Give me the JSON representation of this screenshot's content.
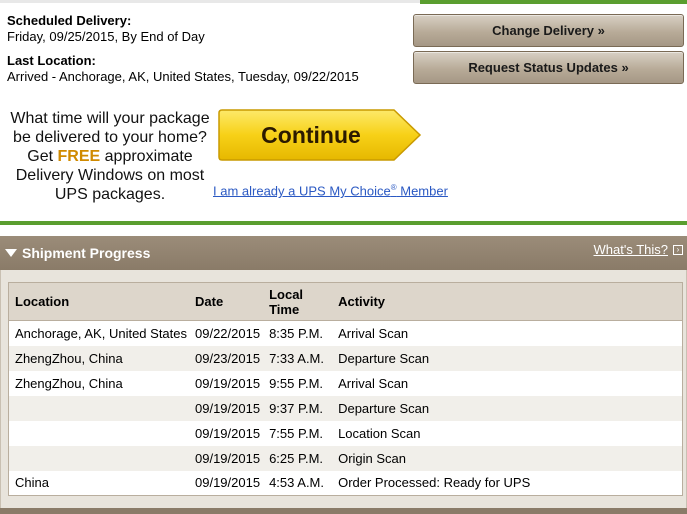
{
  "delivery": {
    "scheduled_label": "Scheduled Delivery:",
    "scheduled_value": "Friday, 09/25/2015, By End of Day",
    "last_location_label": "Last Location:",
    "last_location_value": "Arrived - Anchorage, AK, United States, Tuesday, 09/22/2015"
  },
  "buttons": {
    "change_delivery": "Change Delivery »",
    "request_updates": "Request Status Updates »"
  },
  "promo": {
    "line1": "What time will your package be delivered to your home? Get ",
    "free": "FREE",
    "line2": " approximate Delivery Windows on most UPS packages.",
    "continue_label": "Continue",
    "member_link_prefix": "I am already a UPS My Choice",
    "member_link_reg": "®",
    "member_link_suffix": " Member"
  },
  "shipment_progress": {
    "title": "Shipment Progress",
    "whats_this": "What's This?",
    "columns": {
      "location": "Location",
      "date": "Date",
      "local_time": "Local Time",
      "activity": "Activity"
    },
    "rows": [
      {
        "location": "Anchorage, AK, United States",
        "date": "09/22/2015",
        "time": "8:35 P.M.",
        "activity": "Arrival Scan"
      },
      {
        "location": "ZhengZhou, China",
        "date": "09/23/2015",
        "time": "7:33 A.M.",
        "activity": "Departure Scan"
      },
      {
        "location": "ZhengZhou, China",
        "date": "09/19/2015",
        "time": "9:55 P.M.",
        "activity": "Arrival Scan"
      },
      {
        "location": "",
        "date": "09/19/2015",
        "time": "9:37 P.M.",
        "activity": "Departure Scan"
      },
      {
        "location": "",
        "date": "09/19/2015",
        "time": "7:55 P.M.",
        "activity": "Location Scan"
      },
      {
        "location": "",
        "date": "09/19/2015",
        "time": "6:25 P.M.",
        "activity": "Origin Scan"
      },
      {
        "location": "China",
        "date": "09/19/2015",
        "time": "4:53 A.M.",
        "activity": "Order Processed: Ready for UPS"
      }
    ]
  },
  "colors": {
    "accent_green": "#5a9e2f",
    "section_brown": "#8a7b68",
    "continue_yellow": "#f7d117",
    "free_orange": "#d08a00",
    "link_blue": "#2b59c3"
  }
}
